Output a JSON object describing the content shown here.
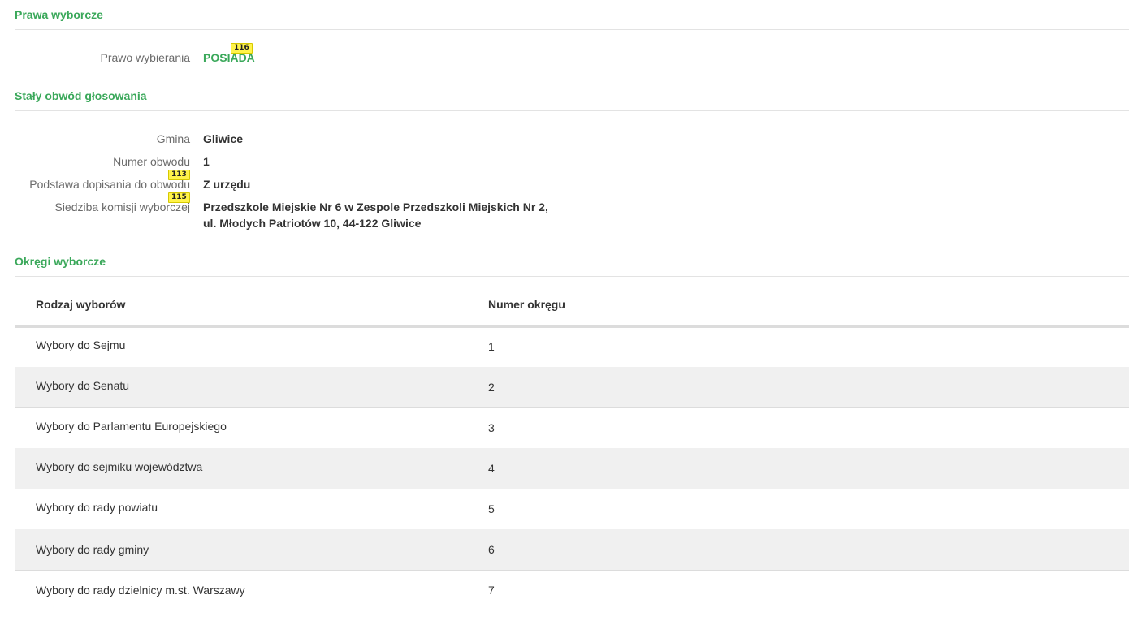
{
  "prawa": {
    "title": "Prawa wyborcze",
    "prawo_label": "Prawo wybierania",
    "prawo_value": "POSIADA",
    "prawo_badge": "116"
  },
  "obwod": {
    "title": "Stały obwód głosowania",
    "gmina_label": "Gmina",
    "gmina_value": "Gliwice",
    "numer_label": "Numer obwodu",
    "numer_value": "1",
    "podstawa_label": "Podstawa dopisania do obwodu",
    "podstawa_value": "Z urzędu",
    "podstawa_badge": "113",
    "siedziba_label": "Siedziba komisji wyborczej",
    "siedziba_line1": "Przedszkole Miejskie Nr 6 w Zespole Przedszkoli Miejskich Nr 2,",
    "siedziba_line2": "ul. Młodych Patriotów 10, 44-122 Gliwice",
    "siedziba_badge": "115"
  },
  "okregi": {
    "title": "Okręgi wyborcze",
    "col_type": "Rodzaj wyborów",
    "col_num": "Numer okręgu",
    "rows": [
      {
        "type": "Wybory do Sejmu",
        "num": "1"
      },
      {
        "type": "Wybory do Senatu",
        "num": "2"
      },
      {
        "type": "Wybory do Parlamentu Europejskiego",
        "num": "3"
      },
      {
        "type": "Wybory do sejmiku województwa",
        "num": "4"
      },
      {
        "type": "Wybory do rady powiatu",
        "num": "5"
      },
      {
        "type": "Wybory do rady gminy",
        "num": "6"
      },
      {
        "type": "Wybory do rady dzielnicy m.st. Warszawy",
        "num": "7"
      }
    ]
  },
  "colors": {
    "accent": "#3aa85a",
    "badge": "#fff34a",
    "row_alt": "#f0f0f0"
  }
}
